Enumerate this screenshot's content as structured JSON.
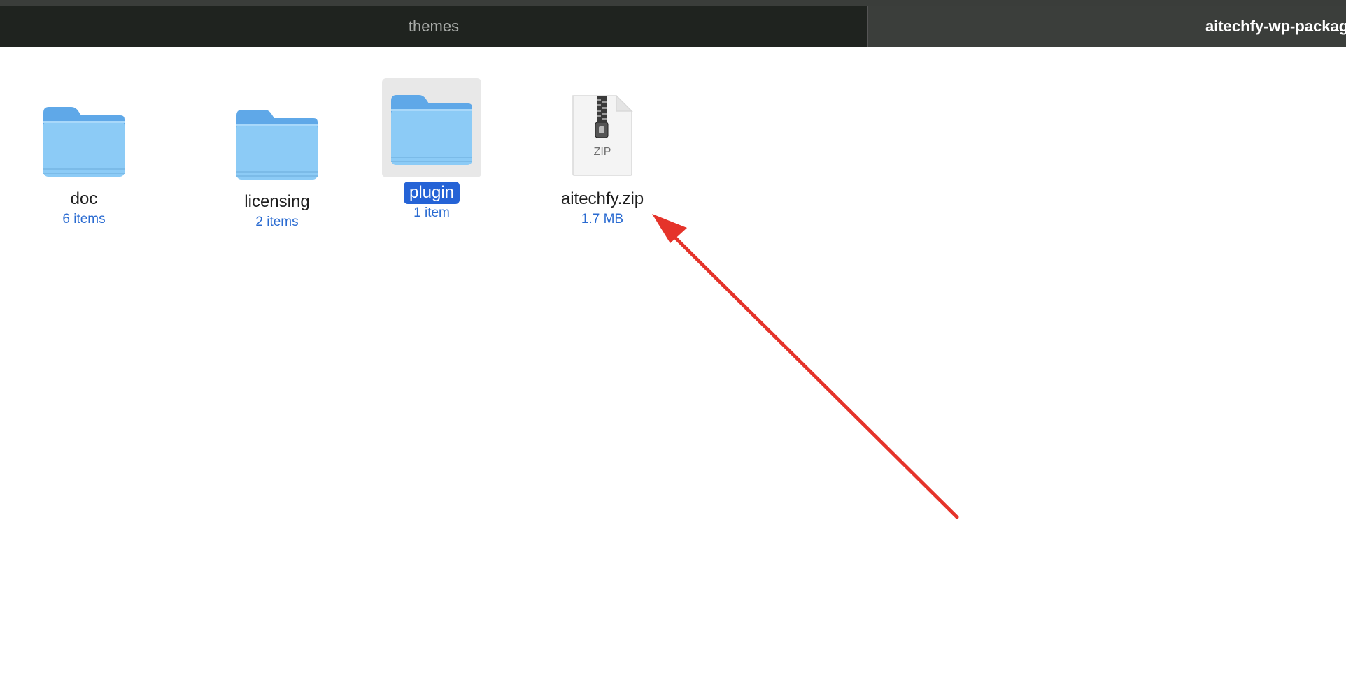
{
  "window": {
    "tabs": [
      {
        "label": "themes",
        "active": false
      },
      {
        "label": "aitechfy-wp-package",
        "active": true
      }
    ]
  },
  "files": [
    {
      "name": "doc",
      "meta": "6 items",
      "kind": "folder",
      "icon": "folder-icon",
      "selected": false
    },
    {
      "name": "licensing",
      "meta": "2 items",
      "kind": "folder",
      "icon": "folder-icon",
      "selected": false
    },
    {
      "name": "plugin",
      "meta": "1 item",
      "kind": "folder",
      "icon": "folder-icon",
      "selected": true
    },
    {
      "name": "aitechfy.zip",
      "meta": "1.7 MB",
      "kind": "zip",
      "icon": "zip-archive-icon",
      "badge": "ZIP",
      "selected": false
    }
  ],
  "annotation": {
    "type": "arrow",
    "color": "#e5332a",
    "points_to": "aitechfy.zip"
  },
  "colors": {
    "folder_back": "#5fa8e8",
    "folder_front": "#8ccbf6",
    "selection": "#2563d6",
    "meta_text": "#2a6bd1"
  }
}
